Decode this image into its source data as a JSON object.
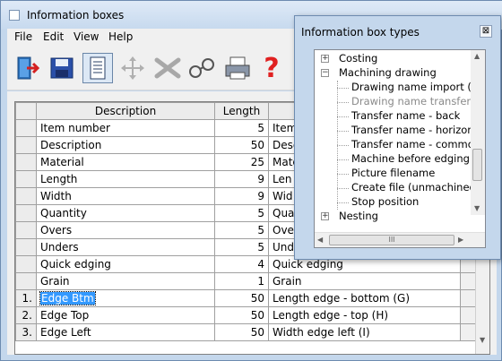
{
  "app": {
    "title": "Information boxes"
  },
  "menu": [
    "File",
    "Edit",
    "View",
    "Help"
  ],
  "toolbar": {
    "icons": [
      "exit-icon",
      "save-icon",
      "list-icon",
      "move-icon",
      "delete-icon",
      "glasses-icon",
      "print-icon",
      "help-icon"
    ],
    "help_glyph": "?"
  },
  "grid": {
    "headers": [
      "Description",
      "Length",
      ""
    ],
    "rows": [
      {
        "num": "",
        "desc": "Item number",
        "len": "5",
        "val": "Item"
      },
      {
        "num": "",
        "desc": "Description",
        "len": "50",
        "val": "Desc"
      },
      {
        "num": "",
        "desc": "Material",
        "len": "25",
        "val": "Mate"
      },
      {
        "num": "",
        "desc": "Length",
        "len": "9",
        "val": "Len"
      },
      {
        "num": "",
        "desc": "Width",
        "len": "9",
        "val": "Wid"
      },
      {
        "num": "",
        "desc": "Quantity",
        "len": "5",
        "val": "Qua"
      },
      {
        "num": "",
        "desc": "Overs",
        "len": "5",
        "val": "Ove"
      },
      {
        "num": "",
        "desc": "Unders",
        "len": "5",
        "val": "Und"
      },
      {
        "num": "",
        "desc": "Quick edging",
        "len": "4",
        "val": "Quick edging"
      },
      {
        "num": "",
        "desc": "Grain",
        "len": "1",
        "val": "Grain"
      },
      {
        "num": "1.",
        "desc": "Edge Btm",
        "len": "50",
        "val": "Length edge - bottom (G)"
      },
      {
        "num": "2.",
        "desc": "Edge Top",
        "len": "50",
        "val": "Length edge - top (H)"
      },
      {
        "num": "3.",
        "desc": "Edge Left",
        "len": "50",
        "val": "Width edge left (I)"
      }
    ]
  },
  "popup": {
    "title": "Information box types",
    "close_glyph": "⊠",
    "tree": [
      {
        "label": "Costing",
        "expander": "+",
        "level": 0,
        "gray": false
      },
      {
        "label": "Machining drawing",
        "expander": "−",
        "level": 0,
        "gray": false
      },
      {
        "label": "Drawing name import (S)",
        "level": 1,
        "gray": false
      },
      {
        "label": "Drawing name transfer (U)",
        "level": 1,
        "gray": true
      },
      {
        "label": "Transfer name - back",
        "level": 1,
        "gray": false
      },
      {
        "label": "Transfer name - horizontal",
        "level": 1,
        "gray": false
      },
      {
        "label": "Transfer name - common",
        "level": 1,
        "gray": false
      },
      {
        "label": "Machine before edging",
        "level": 1,
        "gray": false
      },
      {
        "label": "Picture filename",
        "level": 1,
        "gray": false
      },
      {
        "label": "Create file (unmachined part)",
        "level": 1,
        "gray": false
      },
      {
        "label": "Stop position",
        "level": 1,
        "gray": false
      },
      {
        "label": "Nesting",
        "expander": "+",
        "level": 0,
        "gray": false
      }
    ],
    "hscroll_grip": "III"
  }
}
